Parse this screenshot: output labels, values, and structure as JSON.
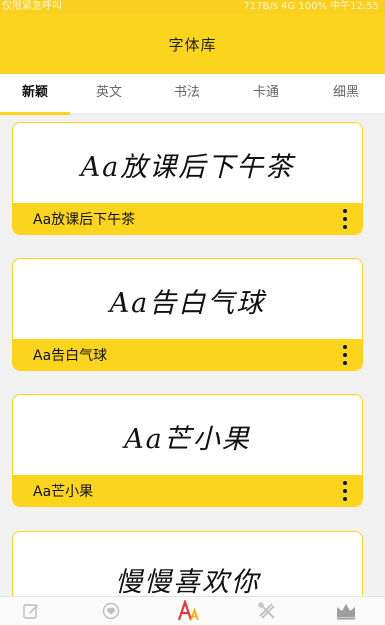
{
  "status_bar": {
    "left_text": "仅限紧急呼叫",
    "right_text": "717B/s 4G 100% 中午12:55"
  },
  "app_bar": {
    "title": "字体库"
  },
  "tabs": [
    {
      "label": "新颖",
      "active": true
    },
    {
      "label": "英文",
      "active": false
    },
    {
      "label": "书法",
      "active": false
    },
    {
      "label": "卡通",
      "active": false
    },
    {
      "label": "细黑",
      "active": false
    }
  ],
  "fonts": [
    {
      "preview": "Aa放课后下午茶",
      "name": "Aa放课后下午茶"
    },
    {
      "preview": "Aa告白气球",
      "name": "Aa告白气球"
    },
    {
      "preview": "Aa芒小果",
      "name": "Aa芒小果"
    },
    {
      "preview": "慢慢喜欢你",
      "name": ""
    }
  ],
  "bottom_nav": [
    {
      "icon": "edit-icon"
    },
    {
      "icon": "heart-icon"
    },
    {
      "icon": "font-icon",
      "active": true
    },
    {
      "icon": "tools-icon"
    },
    {
      "icon": "crown-icon"
    }
  ],
  "colors": {
    "accent": "#fbd51d",
    "active_font_icon": "#e53935"
  }
}
